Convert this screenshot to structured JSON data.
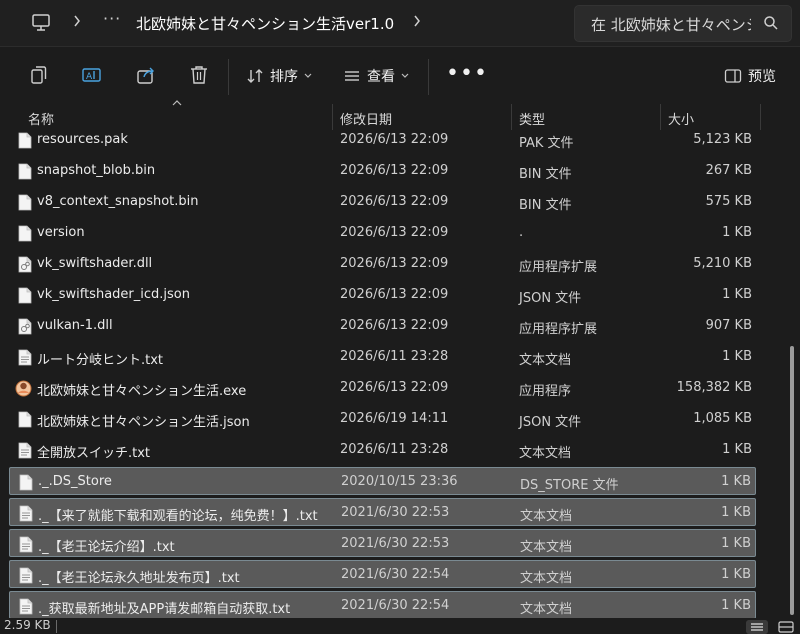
{
  "address_bar": {
    "crumb": "北欧姉妹と甘々ペンション生活ver1.0",
    "overflow": "···",
    "search_placeholder": "在 北欧姉妹と甘々ペンシ"
  },
  "toolbar": {
    "sort_label": "排序",
    "view_label": "查看",
    "more_label": "•••",
    "preview_label": "预览"
  },
  "columns": {
    "name": "名称",
    "date": "修改日期",
    "type": "类型",
    "size": "大小"
  },
  "files": [
    {
      "name": "resources.pak",
      "date": "2026/6/13 22:09",
      "type": "PAK 文件",
      "size": "5,123 KB",
      "icon": "file-icon",
      "selected": false
    },
    {
      "name": "snapshot_blob.bin",
      "date": "2026/6/13 22:09",
      "type": "BIN 文件",
      "size": "267 KB",
      "icon": "file-icon",
      "selected": false
    },
    {
      "name": "v8_context_snapshot.bin",
      "date": "2026/6/13 22:09",
      "type": "BIN 文件",
      "size": "575 KB",
      "icon": "file-icon",
      "selected": false
    },
    {
      "name": "version",
      "date": "2026/6/13 22:09",
      "type": ".",
      "size": "1 KB",
      "icon": "file-icon",
      "selected": false
    },
    {
      "name": "vk_swiftshader.dll",
      "date": "2026/6/13 22:09",
      "type": "应用程序扩展",
      "size": "5,210 KB",
      "icon": "dll-icon",
      "selected": false
    },
    {
      "name": "vk_swiftshader_icd.json",
      "date": "2026/6/13 22:09",
      "type": "JSON 文件",
      "size": "1 KB",
      "icon": "file-icon",
      "selected": false
    },
    {
      "name": "vulkan-1.dll",
      "date": "2026/6/13 22:09",
      "type": "应用程序扩展",
      "size": "907 KB",
      "icon": "dll-icon",
      "selected": false
    },
    {
      "name": "ルート分岐ヒント.txt",
      "date": "2026/6/11 23:28",
      "type": "文本文档",
      "size": "1 KB",
      "icon": "text-file-icon",
      "selected": false
    },
    {
      "name": "北欧姉妹と甘々ペンション生活.exe",
      "date": "2026/6/13 22:09",
      "type": "应用程序",
      "size": "158,382 KB",
      "icon": "app-icon",
      "selected": false
    },
    {
      "name": "北欧姉妹と甘々ペンション生活.json",
      "date": "2026/6/19 14:11",
      "type": "JSON 文件",
      "size": "1,085 KB",
      "icon": "file-icon",
      "selected": false
    },
    {
      "name": "全開放スイッチ.txt",
      "date": "2026/6/11 23:28",
      "type": "文本文档",
      "size": "1 KB",
      "icon": "text-file-icon",
      "selected": false
    },
    {
      "name": "._.DS_Store",
      "date": "2020/10/15 23:36",
      "type": "DS_STORE 文件",
      "size": "1 KB",
      "icon": "file-icon",
      "selected": true
    },
    {
      "name": "._【来了就能下载和观看的论坛，纯免费！】.txt",
      "date": "2021/6/30 22:53",
      "type": "文本文档",
      "size": "1 KB",
      "icon": "text-file-icon",
      "selected": true
    },
    {
      "name": "._【老王论坛介绍】.txt",
      "date": "2021/6/30 22:53",
      "type": "文本文档",
      "size": "1 KB",
      "icon": "text-file-icon",
      "selected": true
    },
    {
      "name": "._【老王论坛永久地址发布页】.txt",
      "date": "2021/6/30 22:54",
      "type": "文本文档",
      "size": "1 KB",
      "icon": "text-file-icon",
      "selected": true
    },
    {
      "name": "._获取最新地址及APP请发邮箱自动获取.txt",
      "date": "2021/6/30 22:54",
      "type": "文本文档",
      "size": "1 KB",
      "icon": "text-file-icon",
      "selected": true
    }
  ],
  "status": {
    "text": "2.59 KB"
  },
  "colors": {
    "background": "#1c1c1c",
    "selection": "#5a5a5a",
    "selection_border": "#7a8a92"
  }
}
